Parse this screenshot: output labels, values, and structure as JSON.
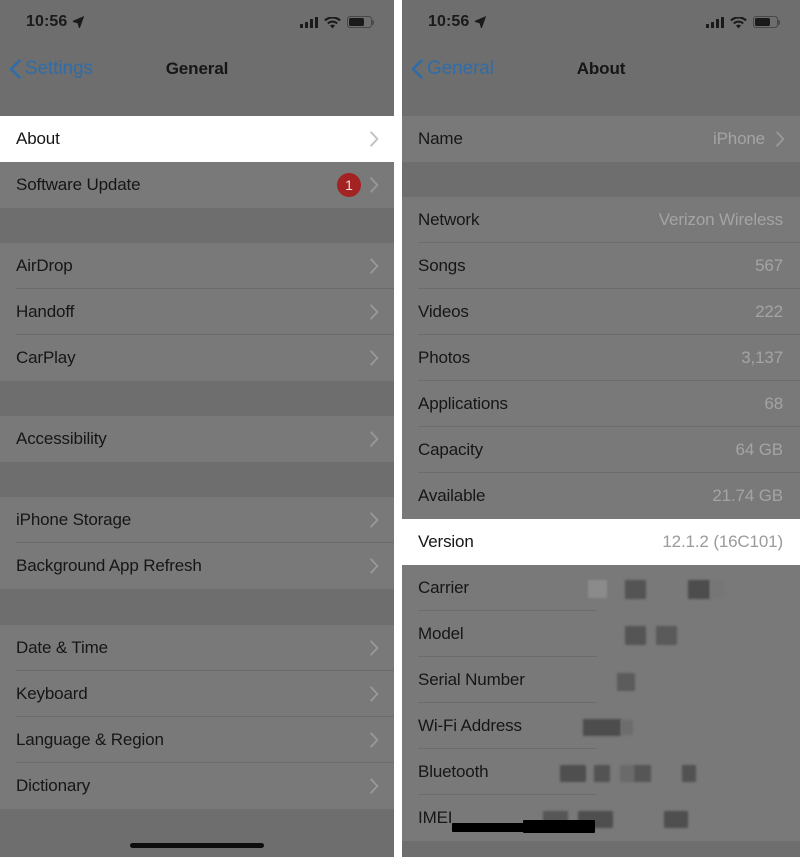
{
  "status_bar": {
    "time": "10:56",
    "location_icon": "location-arrow-icon",
    "signal_icon": "cellular-signal-icon",
    "wifi_icon": "wifi-icon",
    "battery_icon": "battery-icon"
  },
  "left_panel": {
    "nav": {
      "back_label": "Settings",
      "back_icon": "chevron-left-icon",
      "title": "General"
    },
    "sections": [
      {
        "rows": [
          {
            "label": "About",
            "highlighted": true,
            "accessory": "chevron"
          },
          {
            "label": "Software Update",
            "badge": "1",
            "accessory": "chevron"
          }
        ]
      },
      {
        "rows": [
          {
            "label": "AirDrop",
            "accessory": "chevron"
          },
          {
            "label": "Handoff",
            "accessory": "chevron"
          },
          {
            "label": "CarPlay",
            "accessory": "chevron"
          }
        ]
      },
      {
        "rows": [
          {
            "label": "Accessibility",
            "accessory": "chevron"
          }
        ]
      },
      {
        "rows": [
          {
            "label": "iPhone Storage",
            "accessory": "chevron"
          },
          {
            "label": "Background App Refresh",
            "accessory": "chevron"
          }
        ]
      },
      {
        "rows": [
          {
            "label": "Date & Time",
            "accessory": "chevron"
          },
          {
            "label": "Keyboard",
            "accessory": "chevron"
          },
          {
            "label": "Language & Region",
            "accessory": "chevron"
          },
          {
            "label": "Dictionary",
            "accessory": "chevron"
          }
        ]
      }
    ]
  },
  "right_panel": {
    "nav": {
      "back_label": "General",
      "back_icon": "chevron-left-icon",
      "title": "About"
    },
    "sections": [
      {
        "rows": [
          {
            "label": "Name",
            "value": "iPhone",
            "accessory": "chevron"
          }
        ]
      },
      {
        "rows": [
          {
            "label": "Network",
            "value": "Verizon Wireless"
          },
          {
            "label": "Songs",
            "value": "567"
          },
          {
            "label": "Videos",
            "value": "222"
          },
          {
            "label": "Photos",
            "value": "3,137"
          },
          {
            "label": "Applications",
            "value": "68"
          },
          {
            "label": "Capacity",
            "value": "64 GB"
          },
          {
            "label": "Available",
            "value": "21.74 GB"
          },
          {
            "label": "Version",
            "value": "12.1.2 (16C101)",
            "highlighted": true
          },
          {
            "label": "Carrier",
            "value": "",
            "redacted": true
          },
          {
            "label": "Model",
            "value": "",
            "redacted": true
          },
          {
            "label": "Serial Number",
            "value": "",
            "redacted": true
          },
          {
            "label": "Wi-Fi Address",
            "value": "",
            "redacted": true
          },
          {
            "label": "Bluetooth",
            "value": "",
            "redacted": true
          },
          {
            "label": "IMEI",
            "value": "",
            "redacted": true
          }
        ]
      }
    ]
  },
  "colors": {
    "accent_blue": "#2f6ca8",
    "badge_red": "#a32222",
    "dim_background": "#6e6e6e",
    "dim_cell": "#797979",
    "highlight_cell": "#ffffff",
    "value_gray": "#a4a4a4"
  }
}
